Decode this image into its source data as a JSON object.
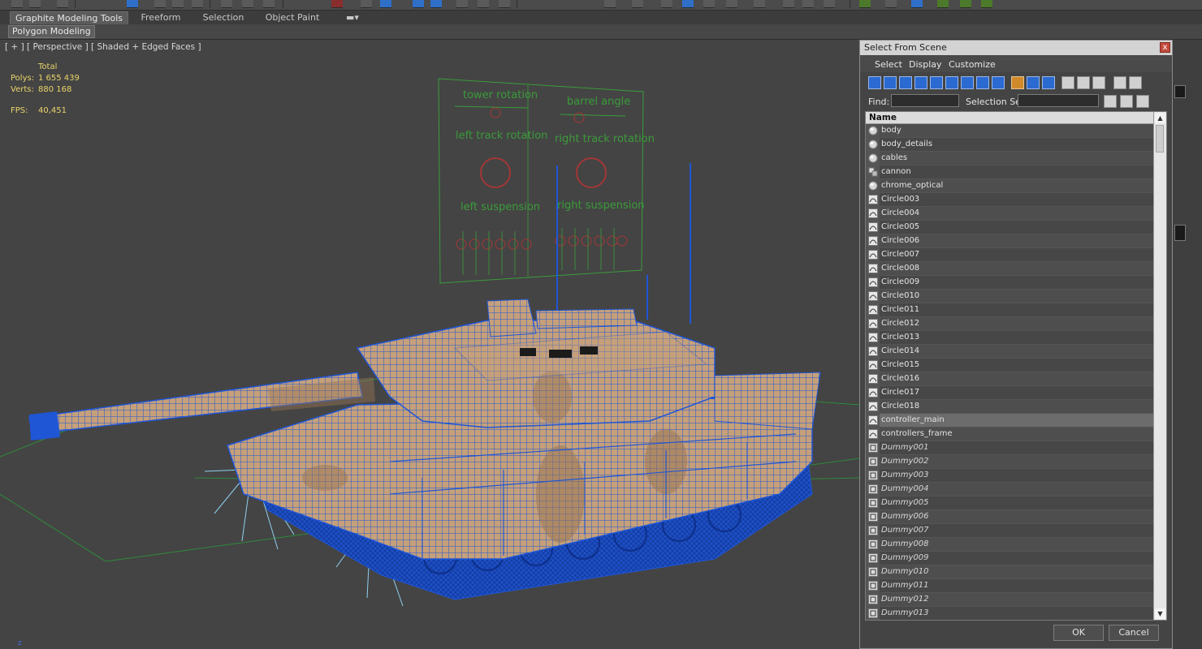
{
  "ribbon": {
    "tabs": [
      {
        "label": "Graphite Modeling Tools",
        "active": true
      },
      {
        "label": "Freeform",
        "active": false
      },
      {
        "label": "Selection",
        "active": false
      },
      {
        "label": "Object Paint",
        "active": false
      }
    ],
    "panel_button": "Polygon Modeling"
  },
  "viewport": {
    "label": "[ + ] [ Perspective ] [ Shaded + Edged Faces ]",
    "stats": {
      "total_label": "Total",
      "polys_label": "Polys:",
      "polys_value": "1 655 439",
      "verts_label": "Verts:",
      "verts_value": "880 168",
      "fps_label": "FPS:",
      "fps_value": "40,451"
    },
    "controller_labels": {
      "tower_rotation": "tower rotation",
      "barrel_angle": "barrel angle",
      "left_track_rotation": "left track rotation",
      "right_track_rotation": "right track rotation",
      "left_suspension": "left suspension",
      "right_suspension": "right suspension"
    },
    "axis_label": "z"
  },
  "dialog": {
    "title": "Select From Scene",
    "close_glyph": "x",
    "menu": [
      "Select",
      "Display",
      "Customize"
    ],
    "find_label": "Find:",
    "find_value": "",
    "selection_set_label": "Selection Set:",
    "selection_set_value": "",
    "column_header": "Name",
    "ok_label": "OK",
    "cancel_label": "Cancel",
    "items": [
      {
        "name": "body",
        "icon": "geometry-sphere-icon",
        "italic": false
      },
      {
        "name": "body_details",
        "icon": "geometry-sphere-icon",
        "italic": false
      },
      {
        "name": "cables",
        "icon": "geometry-sphere-icon",
        "italic": false
      },
      {
        "name": "cannon",
        "icon": "group-icon",
        "italic": false
      },
      {
        "name": "chrome_optical",
        "icon": "geometry-sphere-icon",
        "italic": false
      },
      {
        "name": "Circle003",
        "icon": "shape-icon",
        "italic": false
      },
      {
        "name": "Circle004",
        "icon": "shape-icon",
        "italic": false
      },
      {
        "name": "Circle005",
        "icon": "shape-icon",
        "italic": false
      },
      {
        "name": "Circle006",
        "icon": "shape-icon",
        "italic": false
      },
      {
        "name": "Circle007",
        "icon": "shape-icon",
        "italic": false
      },
      {
        "name": "Circle008",
        "icon": "shape-icon",
        "italic": false
      },
      {
        "name": "Circle009",
        "icon": "shape-icon",
        "italic": false
      },
      {
        "name": "Circle010",
        "icon": "shape-icon",
        "italic": false
      },
      {
        "name": "Circle011",
        "icon": "shape-icon",
        "italic": false
      },
      {
        "name": "Circle012",
        "icon": "shape-icon",
        "italic": false
      },
      {
        "name": "Circle013",
        "icon": "shape-icon",
        "italic": false
      },
      {
        "name": "Circle014",
        "icon": "shape-icon",
        "italic": false
      },
      {
        "name": "Circle015",
        "icon": "shape-icon",
        "italic": false
      },
      {
        "name": "Circle016",
        "icon": "shape-icon",
        "italic": false
      },
      {
        "name": "Circle017",
        "icon": "shape-icon",
        "italic": false
      },
      {
        "name": "Circle018",
        "icon": "shape-icon",
        "italic": false
      },
      {
        "name": "controller_main",
        "icon": "shape-icon",
        "italic": false,
        "selected": true
      },
      {
        "name": "controllers_frame",
        "icon": "shape-icon",
        "italic": false
      },
      {
        "name": "Dummy001",
        "icon": "helper-icon",
        "italic": true
      },
      {
        "name": "Dummy002",
        "icon": "helper-icon",
        "italic": true
      },
      {
        "name": "Dummy003",
        "icon": "helper-icon",
        "italic": true
      },
      {
        "name": "Dummy004",
        "icon": "helper-icon",
        "italic": true
      },
      {
        "name": "Dummy005",
        "icon": "helper-icon",
        "italic": true
      },
      {
        "name": "Dummy006",
        "icon": "helper-icon",
        "italic": true
      },
      {
        "name": "Dummy007",
        "icon": "helper-icon",
        "italic": true
      },
      {
        "name": "Dummy008",
        "icon": "helper-icon",
        "italic": true
      },
      {
        "name": "Dummy009",
        "icon": "helper-icon",
        "italic": true
      },
      {
        "name": "Dummy010",
        "icon": "helper-icon",
        "italic": true
      },
      {
        "name": "Dummy011",
        "icon": "helper-icon",
        "italic": true
      },
      {
        "name": "Dummy012",
        "icon": "helper-icon",
        "italic": true
      },
      {
        "name": "Dummy013",
        "icon": "helper-icon",
        "italic": true
      }
    ]
  },
  "colors": {
    "wireframe_blue": "#1f56d6",
    "body_tan": "#c6a07a",
    "camo_brown": "#9a7654",
    "controller_green": "#3a9c3a",
    "controller_red": "#a33636",
    "light_cyan": "#8fd0f0",
    "stat_yellow": "#e9d46a"
  }
}
